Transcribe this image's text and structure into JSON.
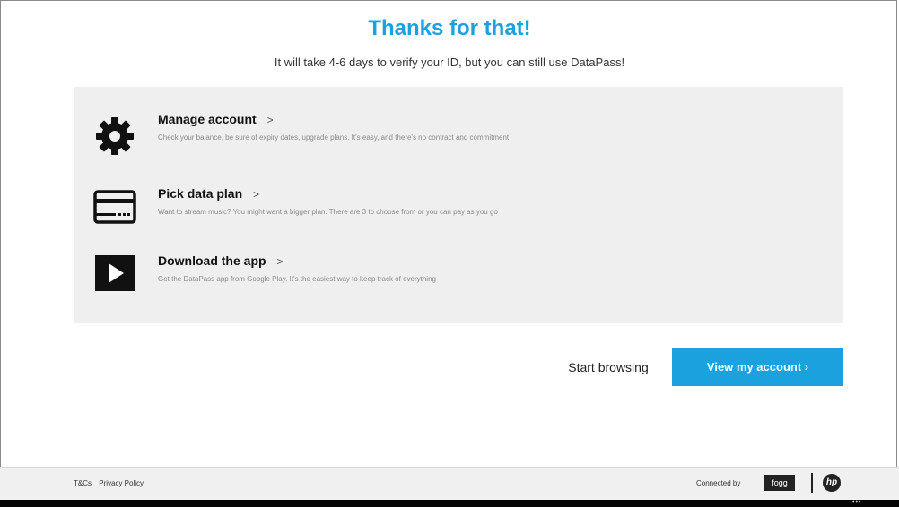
{
  "header": {
    "title": "Thanks for that!",
    "subtitle": "It will take 4-6 days to verify your ID, but you can still use DataPass!"
  },
  "options": [
    {
      "label": "Manage account",
      "chevron": ">",
      "description": "Check your balance, be sure of expiry dates, upgrade plans. It's easy, and there's no contract and commitment",
      "icon": "gear-icon"
    },
    {
      "label": "Pick data plan",
      "chevron": ">",
      "description": "Want to stream music? You might want a bigger plan. There are 3 to choose from or you can pay as you go",
      "icon": "credit-card-icon"
    },
    {
      "label": "Download the app",
      "chevron": ">",
      "description": "Get the DataPass app from Google Play. It's the easiest way to keep track of everything",
      "icon": "play-icon"
    }
  ],
  "actions": {
    "start_browsing": "Start browsing",
    "view_account": "View my account ›"
  },
  "footer": {
    "tcs": "T&Cs",
    "privacy": "Privacy Policy",
    "connected_by": "Connected by",
    "fogg_logo": "fogg",
    "hp_logo": "hp"
  },
  "colors": {
    "accent": "#1ba1dd",
    "panel": "#efefef",
    "footer": "#f0f0f0"
  }
}
